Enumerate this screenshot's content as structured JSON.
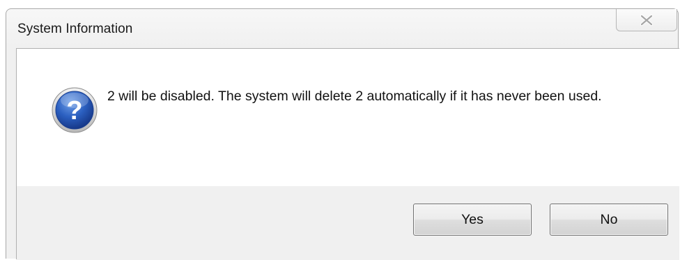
{
  "window": {
    "title": "System Information",
    "close_icon": "close-icon"
  },
  "dialog": {
    "icon": "question-icon",
    "message": "2 will be disabled. The system will delete 2 automatically if it has never been used."
  },
  "buttons": {
    "yes_label": "Yes",
    "no_label": "No"
  },
  "colors": {
    "icon_blue": "#1f4fa8",
    "button_bar": "#f0f0f0",
    "content_bg": "#ffffff"
  }
}
